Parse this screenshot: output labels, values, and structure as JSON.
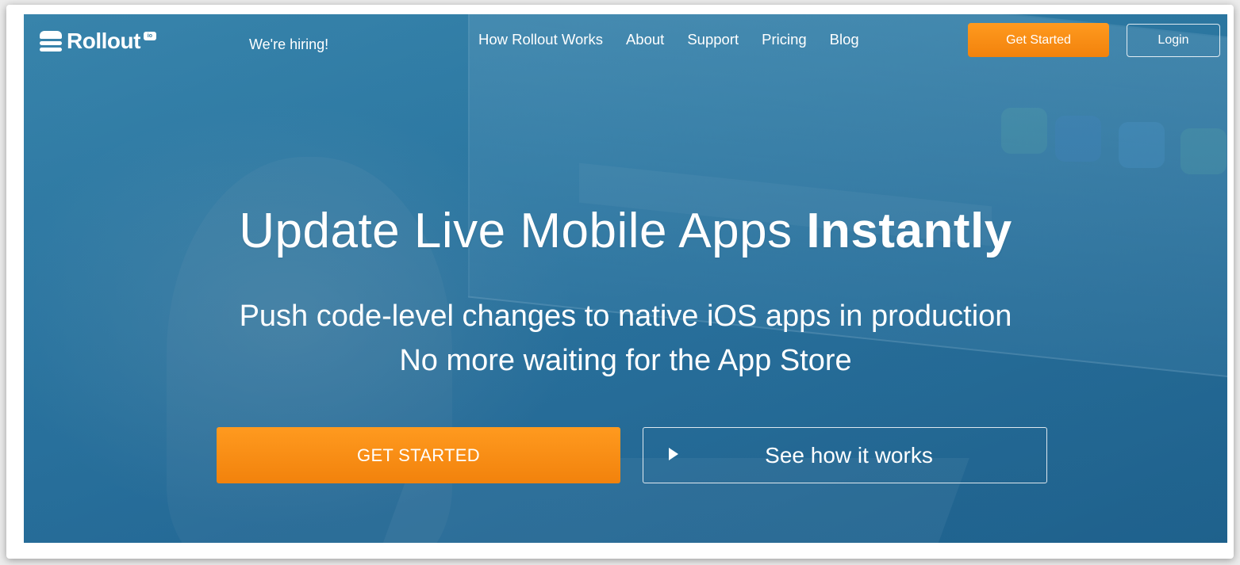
{
  "nav": {
    "logo_text": "Rollout",
    "logo_badge": "io",
    "hiring_label": "We're hiring!",
    "links": [
      "How Rollout Works",
      "About",
      "Support",
      "Pricing",
      "Blog"
    ],
    "get_started_label": "Get Started",
    "login_label": "Login"
  },
  "hero": {
    "headline_light": "Update Live Mobile Apps ",
    "headline_bold": "Instantly",
    "subline1": "Push code-level changes to native iOS apps in production",
    "subline2": "No more waiting for the App Store",
    "cta_primary": "GET STARTED",
    "cta_secondary": "See how it works"
  },
  "colors": {
    "accent_orange": "#f68b14",
    "hero_blue": "#2f7aa2"
  }
}
